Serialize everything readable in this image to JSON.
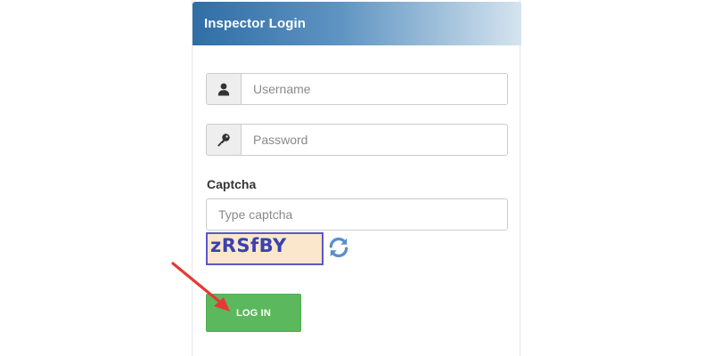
{
  "panel": {
    "title": "Inspector Login"
  },
  "form": {
    "username_placeholder": "Username",
    "username_value": "",
    "password_placeholder": "Password",
    "password_value": "",
    "captcha_label": "Captcha",
    "captcha_placeholder": "Type captcha",
    "captcha_value": "",
    "captcha_image_text": "zRSfBY",
    "login_label": "LOG IN"
  },
  "icons": {
    "username": "user-icon",
    "password": "key-icon",
    "refresh": "refresh-icon",
    "annotation": "red-arrow-annotation"
  },
  "colors": {
    "header_start": "#2f6ea5",
    "header_end": "#d5e4ef",
    "login_button": "#5cb85c",
    "refresh_icon": "#5b8fc9",
    "captcha_bg": "#fbe7cc",
    "captcha_border": "#5b57c8",
    "arrow": "#e53935"
  }
}
